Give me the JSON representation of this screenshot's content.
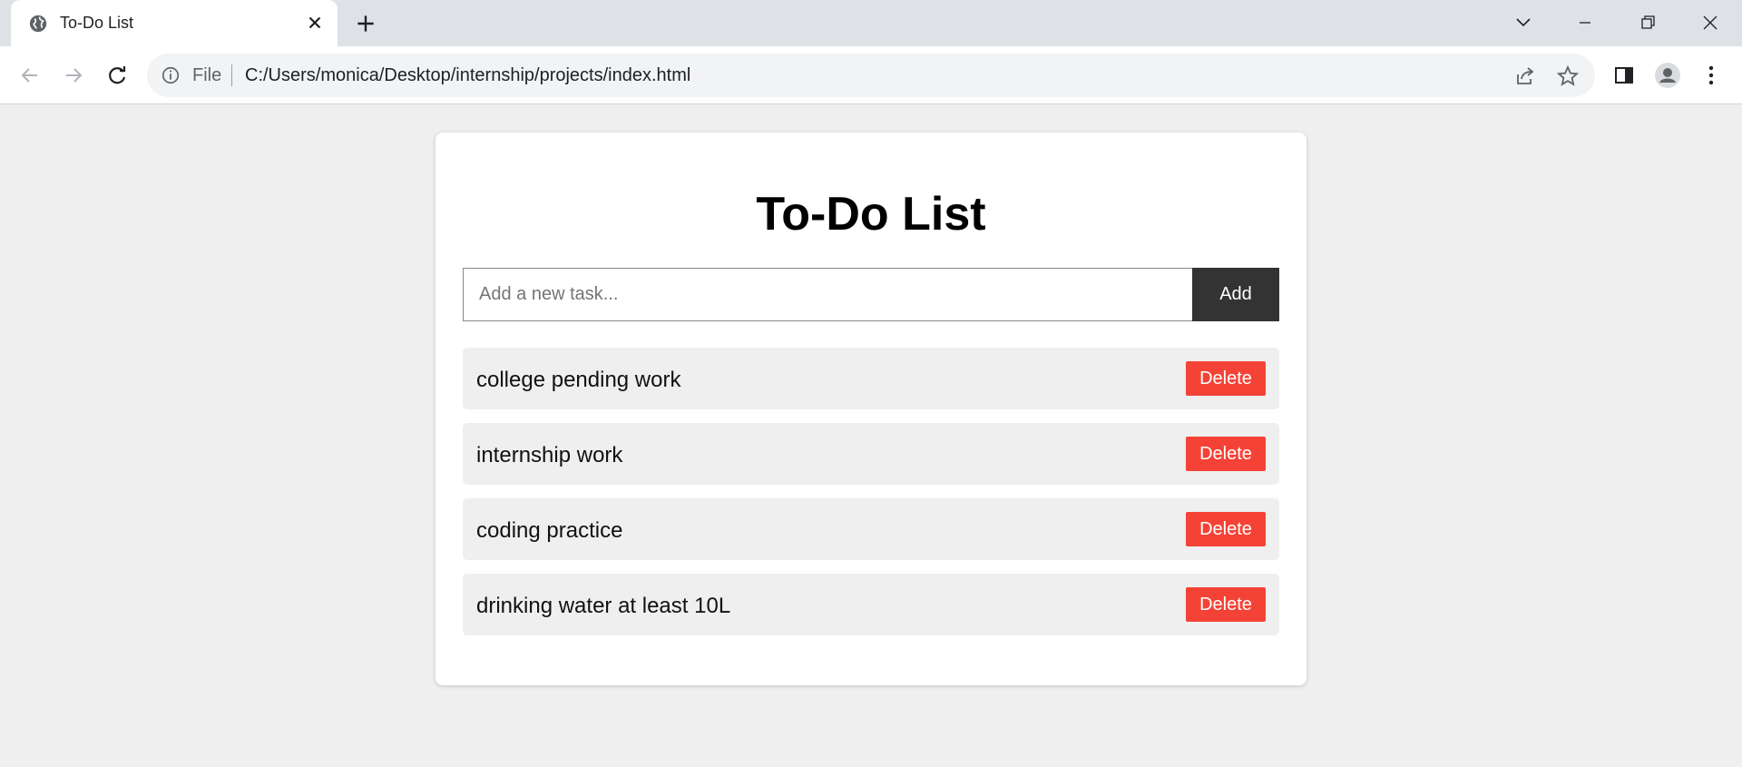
{
  "browser": {
    "tab": {
      "title": "To-Do List"
    },
    "address_bar": {
      "scheme_label": "File",
      "url": "C:/Users/monica/Desktop/internship/projects/index.html"
    },
    "icons": [
      "globe-icon",
      "close-icon",
      "plus-icon",
      "chevron-down-icon",
      "minimize-icon",
      "restore-icon",
      "window-close-icon",
      "back-icon",
      "forward-icon",
      "reload-icon",
      "info-icon",
      "share-icon",
      "star-icon",
      "side-panel-icon",
      "profile-icon",
      "menu-icon"
    ]
  },
  "app": {
    "title": "To-Do List",
    "input": {
      "placeholder": "Add a new task...",
      "value": ""
    },
    "add_label": "Add",
    "tasks": [
      {
        "text": "college pending work",
        "delete_label": "Delete"
      },
      {
        "text": "internship work",
        "delete_label": "Delete"
      },
      {
        "text": "coding practice",
        "delete_label": "Delete"
      },
      {
        "text": "drinking water at least 10L",
        "delete_label": "Delete"
      }
    ]
  },
  "colors": {
    "page_background": "#efefef",
    "card_background": "#ffffff",
    "add_button": "#333333",
    "delete_button": "#f44336",
    "task_background": "#efefef",
    "tab_strip": "#dee1e6"
  }
}
